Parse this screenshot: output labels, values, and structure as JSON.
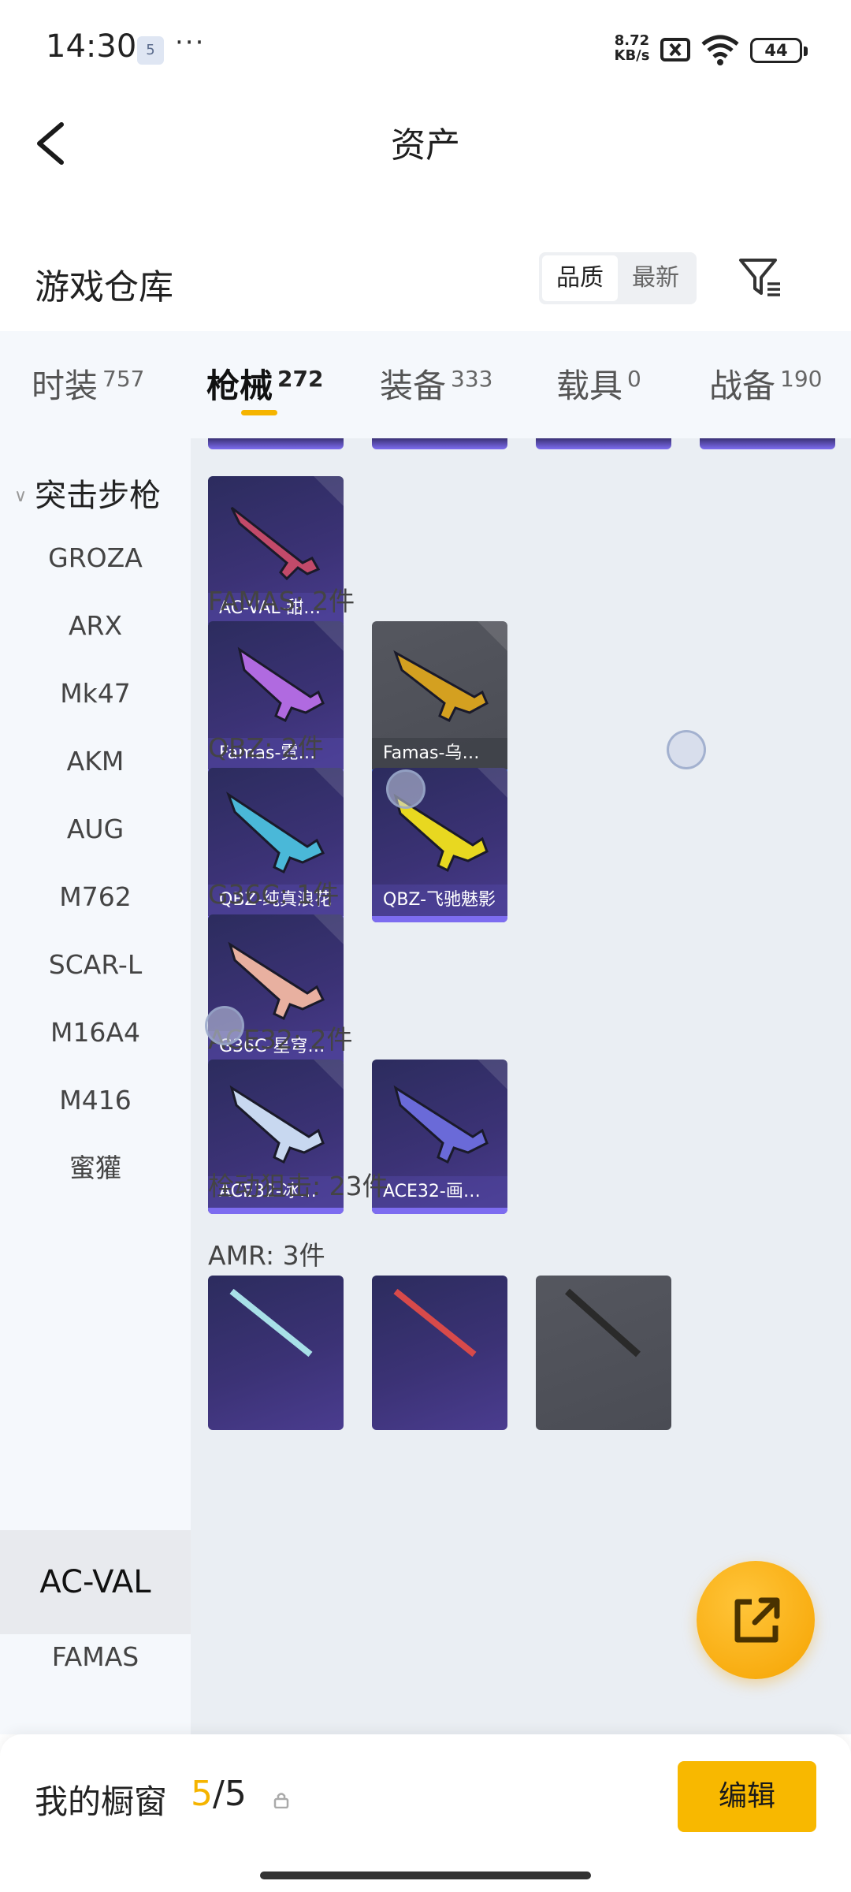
{
  "status_bar": {
    "time": "14:30",
    "notif_badge": "5",
    "more": "···",
    "speed_top": "8.72",
    "speed_bottom": "KB/s",
    "battery": "44"
  },
  "header": {
    "title": "资产"
  },
  "warehouse": {
    "title": "游戏仓库",
    "sort_options": [
      "品质",
      "最新"
    ],
    "active_sort": "品质"
  },
  "tabs": [
    {
      "label": "时装",
      "count": "757"
    },
    {
      "label": "枪械",
      "count": "272",
      "active": true
    },
    {
      "label": "装备",
      "count": "333"
    },
    {
      "label": "载具",
      "count": "0"
    },
    {
      "label": "战备",
      "count": "190"
    }
  ],
  "sidebar": {
    "category": "突击步枪",
    "items": [
      "GROZA",
      "ARX",
      "Mk47",
      "AKM",
      "AUG",
      "M762",
      "SCAR-L",
      "M16A4",
      "M416",
      "蜜獾",
      "AC-VAL",
      "FAMAS"
    ],
    "active": "AC-VAL"
  },
  "content": {
    "groups": [
      {
        "label": "FAMAS: 2件"
      },
      {
        "label": "QBZ: 2件"
      },
      {
        "label": "G36C: 1件"
      },
      {
        "label": "ACE32: 2件"
      },
      {
        "label": "栓动狙击: 23件"
      },
      {
        "label": "AMR: 3件"
      }
    ],
    "cards": [
      {
        "label": "AC-VAL-甜…",
        "color": "#c24a6a"
      },
      {
        "label": "Famas-霓彩…",
        "color": "#b06ae0"
      },
      {
        "label": "Famas-乌木…",
        "color": "#d4a020"
      },
      {
        "label": "QBZ-纯真浪花",
        "color": "#4ab8d8"
      },
      {
        "label": "QBZ-飞驰魅影",
        "color": "#e8d820"
      },
      {
        "label": "G36C-星穹…",
        "color": "#e8b0a0"
      },
      {
        "label": "ACE32-冰晶…",
        "color": "#c8d8f0"
      },
      {
        "label": "ACE32-画境…",
        "color": "#6a6ad8"
      }
    ]
  },
  "bottom": {
    "label": "我的橱窗",
    "current": "5",
    "sep_total": "/5",
    "edit": "编辑"
  },
  "colors": {
    "accent": "#f5b400",
    "card_bg": "#3b3275",
    "card_bar": "#7d6cf0"
  }
}
